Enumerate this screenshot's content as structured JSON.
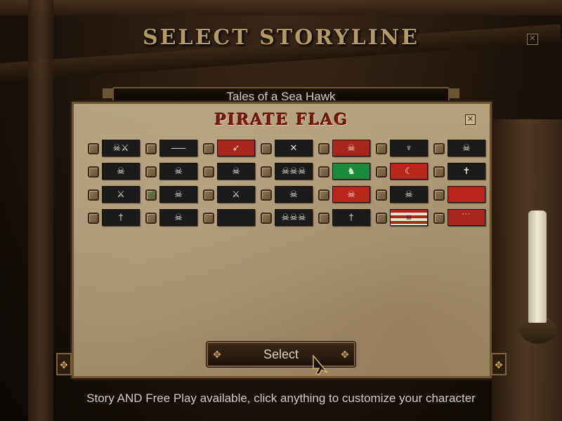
{
  "screen": {
    "title": "SELECT STORYLINE",
    "close_icon": "✕",
    "storyline": "Tales of a Sea Hawk",
    "footer": "Story AND Free Play available, click anything to customize your character"
  },
  "dialog": {
    "title": "PIRATE FLAG",
    "close_icon": "✕",
    "select_label": "Select",
    "flags": [
      [
        {
          "icon": "☠⚔",
          "color": "#1b1b1b",
          "checked": false
        },
        {
          "icon": "⸺",
          "color": "#1b1b1b",
          "checked": false
        },
        {
          "icon": "➶",
          "color": "#a8271a",
          "checked": false
        },
        {
          "icon": "✕",
          "color": "#1b1b1b",
          "checked": false
        },
        {
          "icon": "☠",
          "color": "#a8271a",
          "checked": false
        },
        {
          "icon": "♆",
          "color": "#1b1b1b",
          "checked": false
        },
        {
          "icon": "☠",
          "color": "#1b1b1b",
          "checked": false
        }
      ],
      [
        {
          "icon": "☠",
          "color": "#1b1b1b",
          "checked": false
        },
        {
          "icon": "☠",
          "color": "#1b1b1b",
          "checked": false
        },
        {
          "icon": "☠",
          "color": "#1b1b1b",
          "checked": false
        },
        {
          "icon": "☠☠☠",
          "color": "#1b1b1b",
          "checked": false
        },
        {
          "icon": "♞",
          "color": "#1c8a3c",
          "checked": false
        },
        {
          "icon": "☾",
          "color": "#b8261a",
          "checked": false
        },
        {
          "icon": "✝",
          "color": "#1b1b1b",
          "checked": false
        }
      ],
      [
        {
          "icon": "⚔",
          "color": "#1b1b1b",
          "checked": false
        },
        {
          "icon": "☠",
          "color": "#1b1b1b",
          "checked": true
        },
        {
          "icon": "⚔",
          "color": "#1b1b1b",
          "checked": false
        },
        {
          "icon": "☠",
          "color": "#1b1b1b",
          "checked": false
        },
        {
          "icon": "☠",
          "color": "#b8261a",
          "checked": false
        },
        {
          "icon": "☠",
          "color": "#1b1b1b",
          "checked": false
        },
        {
          "icon": "",
          "color": "#b8261a",
          "checked": false
        }
      ],
      [
        {
          "icon": "†",
          "color": "#1b1b1b",
          "checked": false
        },
        {
          "icon": "☠",
          "color": "#1b1b1b",
          "checked": false
        },
        {
          "icon": "",
          "color": "#1b1b1b",
          "checked": false
        },
        {
          "icon": "☠☠☠",
          "color": "#1b1b1b",
          "checked": false
        },
        {
          "icon": "†",
          "color": "#1b1b1b",
          "checked": false
        },
        {
          "icon": "≡",
          "color": "#c8c0ad",
          "checked": false
        },
        {
          "icon": "˙˙˙",
          "color": "#a8271a",
          "checked": false
        }
      ]
    ]
  }
}
